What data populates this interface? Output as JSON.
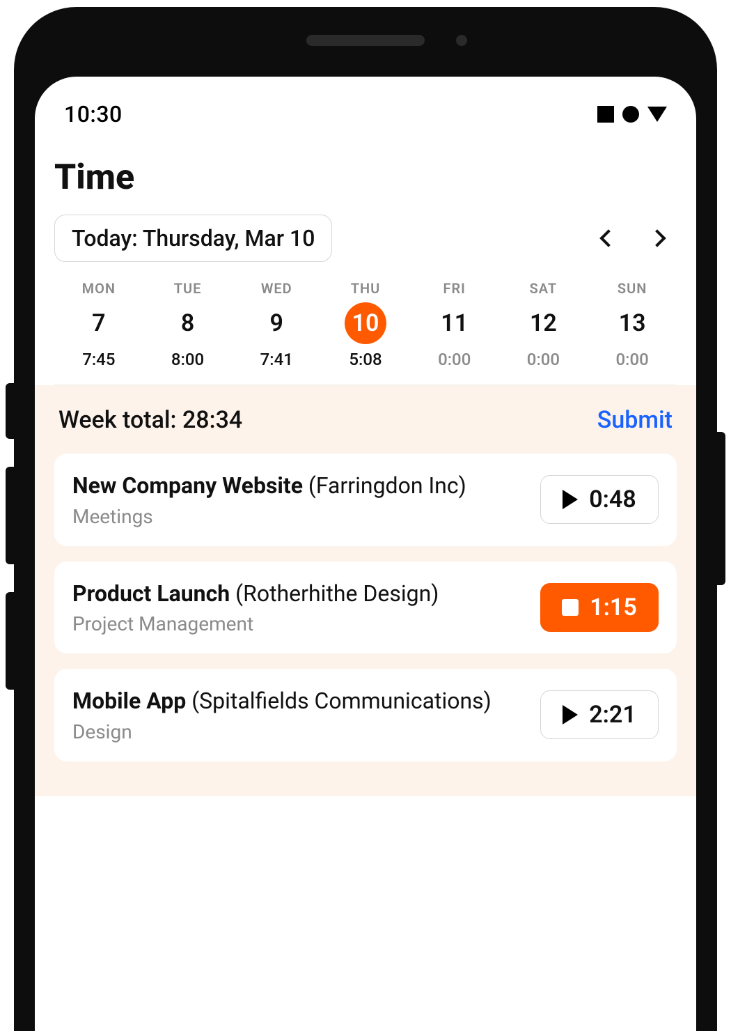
{
  "status": {
    "time": "10:30"
  },
  "header": {
    "title": "Time",
    "date_pill": "Today: Thursday, Mar 10"
  },
  "week": {
    "days": [
      {
        "label": "MON",
        "num": "7",
        "time": "7:45",
        "muted": false,
        "selected": false
      },
      {
        "label": "TUE",
        "num": "8",
        "time": "8:00",
        "muted": false,
        "selected": false
      },
      {
        "label": "WED",
        "num": "9",
        "time": "7:41",
        "muted": false,
        "selected": false
      },
      {
        "label": "THU",
        "num": "10",
        "time": "5:08",
        "muted": false,
        "selected": true
      },
      {
        "label": "FRI",
        "num": "11",
        "time": "0:00",
        "muted": true,
        "selected": false
      },
      {
        "label": "SAT",
        "num": "12",
        "time": "0:00",
        "muted": true,
        "selected": false
      },
      {
        "label": "SUN",
        "num": "13",
        "time": "0:00",
        "muted": true,
        "selected": false
      }
    ]
  },
  "totals": {
    "week_total_label": "Week total: 28:34",
    "submit_label": "Submit"
  },
  "entries": [
    {
      "project": "New Company Website",
      "client": "Farringdon Inc",
      "category": "Meetings",
      "time": "0:48",
      "running": false
    },
    {
      "project": "Product Launch",
      "client": "Rotherhithe Design",
      "category": "Project Management",
      "time": "1:15",
      "running": true
    },
    {
      "project": "Mobile App",
      "client": "Spitalfields Communications",
      "category": "Design",
      "time": "2:21",
      "running": false
    }
  ]
}
